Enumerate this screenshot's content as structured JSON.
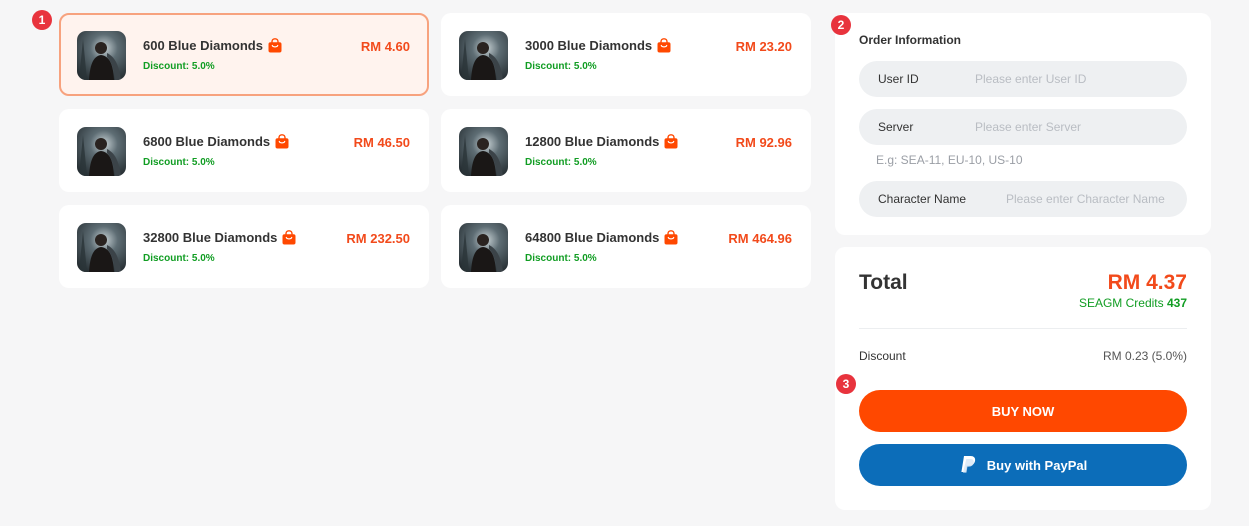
{
  "badges": [
    "1",
    "2",
    "3"
  ],
  "products": [
    {
      "name": "600 Blue Diamonds",
      "price": "RM 4.60",
      "discount": "Discount: 5.0%",
      "selected": true
    },
    {
      "name": "3000 Blue Diamonds",
      "price": "RM 23.20",
      "discount": "Discount: 5.0%",
      "selected": false
    },
    {
      "name": "6800 Blue Diamonds",
      "price": "RM 46.50",
      "discount": "Discount: 5.0%",
      "selected": false
    },
    {
      "name": "12800 Blue Diamonds",
      "price": "RM 92.96",
      "discount": "Discount: 5.0%",
      "selected": false
    },
    {
      "name": "32800 Blue Diamonds",
      "price": "RM 232.50",
      "discount": "Discount: 5.0%",
      "selected": false
    },
    {
      "name": "64800 Blue Diamonds",
      "price": "RM 464.96",
      "discount": "Discount: 5.0%",
      "selected": false
    }
  ],
  "product_icon": "game-avatar-icon",
  "bag_icon": "shopping-bag-icon",
  "order": {
    "title": "Order Information",
    "user_id": {
      "label": "User ID",
      "placeholder": "Please enter User ID",
      "value": ""
    },
    "server": {
      "label": "Server",
      "placeholder": "Please enter Server",
      "value": ""
    },
    "server_hint": "E.g: SEA-11, EU-10, US-10",
    "character": {
      "label": "Character Name",
      "placeholder": "Please enter Character Name",
      "value": ""
    }
  },
  "summary": {
    "total_label": "Total",
    "total_amount": "RM 4.37",
    "credits_label": "SEAGM Credits",
    "credits_value": "437",
    "discount_label": "Discount",
    "discount_value": "RM 0.23 (5.0%)"
  },
  "buttons": {
    "buy_now": "BUY NOW",
    "paypal": "Buy with PayPal"
  },
  "colors": {
    "accent": "#ff4800",
    "price": "#f24a1b",
    "discount_green": "#119d23",
    "paypal_blue": "#0c6db9",
    "badge_red": "#e8333d",
    "selected_border": "#f7a27e"
  }
}
